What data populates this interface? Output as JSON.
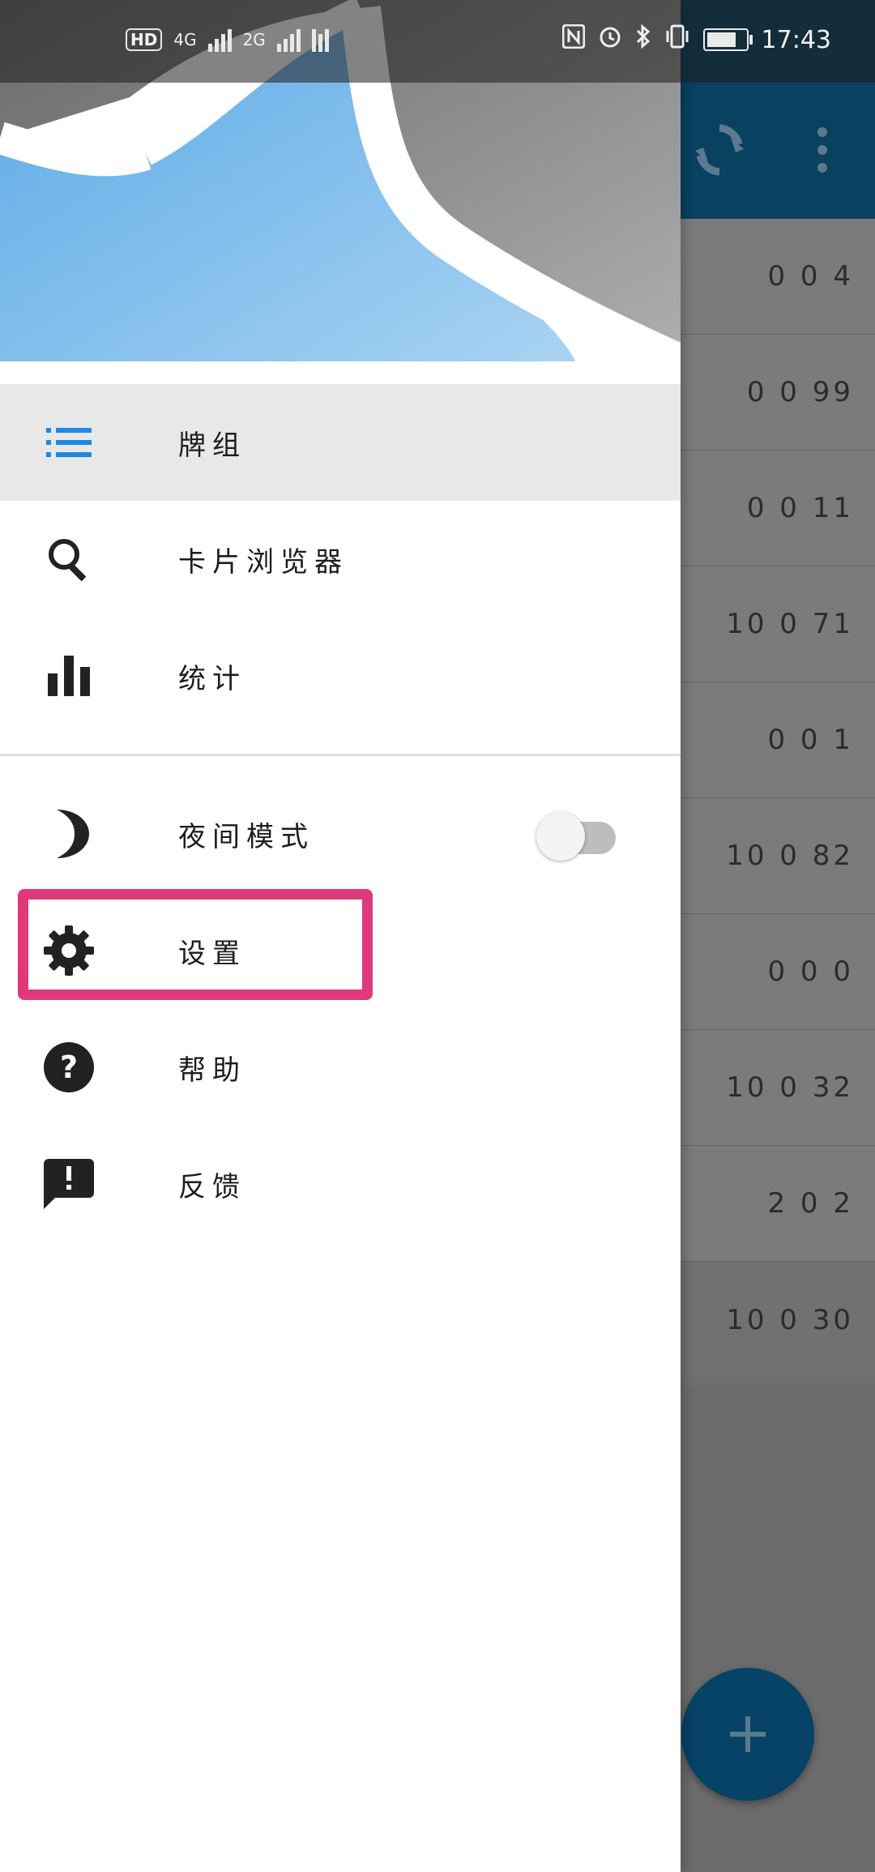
{
  "status_bar": {
    "left_icons": [
      "HD",
      "4G",
      "2G"
    ],
    "time": "17:43",
    "battery_level": 0.75,
    "right_icons": [
      "nfc-icon",
      "alarm-icon",
      "bluetooth-icon",
      "vibrate-icon",
      "battery-icon"
    ]
  },
  "drawer": {
    "nav_items": [
      {
        "label": "牌组",
        "icon": "list-icon",
        "selected": true
      },
      {
        "label": "卡片浏览器",
        "icon": "search-icon"
      },
      {
        "label": "统计",
        "icon": "bar-chart-icon"
      }
    ],
    "secondary_items": [
      {
        "label": "夜间模式",
        "icon": "moon-icon",
        "toggle": false
      },
      {
        "label": "设置",
        "icon": "gear-icon",
        "highlighted": true
      },
      {
        "label": "帮助",
        "icon": "help-icon"
      },
      {
        "label": "反馈",
        "icon": "feedback-icon"
      }
    ]
  },
  "deck_counts": [
    "0 0 4",
    "0 0 99",
    "0 0 11",
    "10 0 71",
    "0 0 1",
    "10 0 82",
    "0 0 0",
    "10 0 32",
    "2 0 2",
    "10 0 30"
  ],
  "colors": {
    "toolbar": "#084260",
    "accent": "#1e88e5",
    "highlight": "#e0387a",
    "fab": "#064366"
  }
}
